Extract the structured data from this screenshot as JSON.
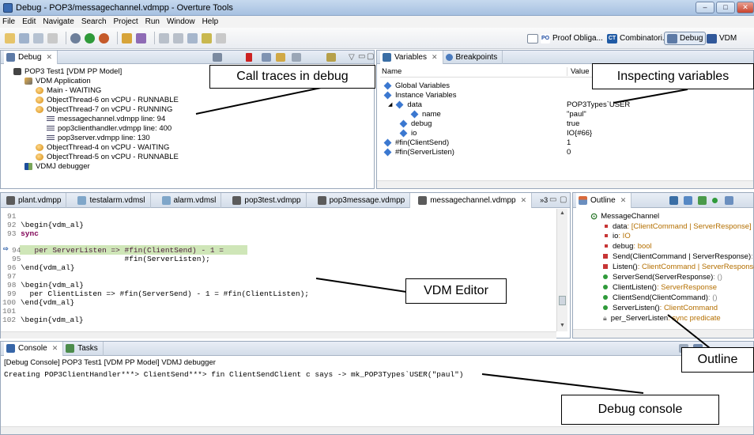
{
  "window": {
    "title": "Debug - POP3/messagechannel.vdmpp - Overture Tools",
    "min": "–",
    "max": "□",
    "close": "✕"
  },
  "menu": [
    "File",
    "Edit",
    "Navigate",
    "Search",
    "Project",
    "Run",
    "Window",
    "Help"
  ],
  "perspectives": {
    "proof": {
      "badge": "PO",
      "label": "Proof Obliga..."
    },
    "comb": {
      "badge": "CT",
      "label": "Combinatori..."
    },
    "debug": {
      "label": "Debug"
    },
    "vdm": {
      "label": "VDM"
    }
  },
  "debug_view": {
    "tab": "Debug",
    "items": [
      {
        "label": "POP3 Test1 [VDM PP Model]"
      },
      {
        "label": "VDM Application"
      },
      {
        "label": "Main - WAITING"
      },
      {
        "label": "ObjectThread-6 on vCPU - RUNNABLE"
      },
      {
        "label": "ObjectThread-7 on vCPU - RUNNING"
      },
      {
        "label": "messagechannel.vdmpp line: 94"
      },
      {
        "label": "pop3clienthandler.vdmpp line: 400"
      },
      {
        "label": "pop3server.vdmpp line: 130"
      },
      {
        "label": "ObjectThread-4 on vCPU - WAITING"
      },
      {
        "label": "ObjectThread-5 on vCPU - RUNNABLE"
      },
      {
        "label": "VDMJ debugger"
      }
    ]
  },
  "variables_view": {
    "tabs": [
      "Variables",
      "Breakpoints"
    ],
    "col_name": "Name",
    "col_value": "Value",
    "rows": [
      {
        "name": "Global Variables",
        "value": ""
      },
      {
        "name": "Instance Variables",
        "value": ""
      },
      {
        "name": "data",
        "value": "POP3Types`USER"
      },
      {
        "name": "name",
        "value": "\"paul\""
      },
      {
        "name": "debug",
        "value": "true"
      },
      {
        "name": "io",
        "value": "IO{#66}"
      },
      {
        "name": "#fin(ClientSend)",
        "value": "1"
      },
      {
        "name": "#fin(ServerListen)",
        "value": "0"
      }
    ]
  },
  "editor": {
    "tabs": [
      "plant.vdmpp",
      "testalarm.vdmsl",
      "alarm.vdmsl",
      "pop3test.vdmpp",
      "pop3message.vdmpp",
      "messagechannel.vdmpp"
    ],
    "overflow": "»3",
    "lines": [
      {
        "num": "91",
        "text": ""
      },
      {
        "num": "92",
        "text": "\\begin{vdm_al}"
      },
      {
        "num": "93",
        "text": "sync"
      },
      {
        "num": "94",
        "text": "  per ServerListen => #fin(ClientSend) - 1 ="
      },
      {
        "num": "95",
        "text": "                      #fin(ServerListen);"
      },
      {
        "num": "96",
        "text": "\\end{vdm_al}"
      },
      {
        "num": "97",
        "text": ""
      },
      {
        "num": "98",
        "text": "\\begin{vdm_al}"
      },
      {
        "num": "99",
        "text": "  per ClientListen => #fin(ServerSend) - 1 = #fin(ClientListen);"
      },
      {
        "num": "100",
        "text": "\\end{vdm_al}"
      },
      {
        "num": "101",
        "text": ""
      },
      {
        "num": "102",
        "text": "\\begin{vdm_al}"
      }
    ]
  },
  "outline": {
    "tab": "Outline",
    "items": [
      {
        "name": "MessageChannel",
        "type": ""
      },
      {
        "name": "data",
        "type": " : [ClientCommand | ServerResponse]"
      },
      {
        "name": "io",
        "type": " : IO"
      },
      {
        "name": "debug",
        "type": " : bool"
      },
      {
        "name": "Send(ClientCommand | ServerResponse)",
        "type": " : ()"
      },
      {
        "name": "Listen()",
        "type": " : ClientCommand | ServerResponse"
      },
      {
        "name": "ServerSend(ServerResponse)",
        "type": " : ()"
      },
      {
        "name": "ClientListen()",
        "type": " : ServerResponse"
      },
      {
        "name": "ClientSend(ClientCommand)",
        "type": " : ()"
      },
      {
        "name": "ServerListen()",
        "type": " : ClientCommand"
      },
      {
        "name": "per_ServerListen",
        "type": " : sync predicate"
      }
    ]
  },
  "console": {
    "tabs": [
      "Console",
      "Tasks"
    ],
    "header": "[Debug Console] POP3 Test1 [VDM PP Model] VDMJ debugger",
    "output": "Creating POP3ClientHandler***> ClientSend***> fin ClientSendClient c says -> mk_POP3Types`USER(\"paul\")"
  },
  "callouts": {
    "call_traces": "Call traces in debug",
    "inspecting": "Inspecting variables",
    "editor": "VDM Editor",
    "outline": "Outline",
    "console": "Debug console"
  }
}
